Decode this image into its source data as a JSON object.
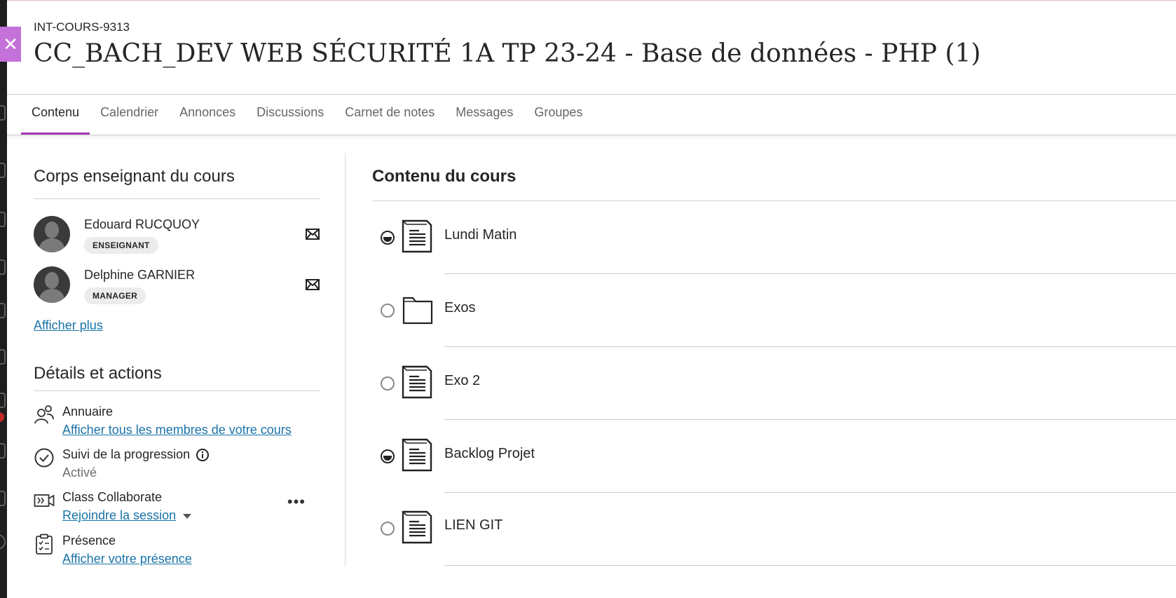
{
  "course": {
    "id": "INT-COURS-9313",
    "title": "CC_BACH_DEV WEB SÉCURITÉ 1A TP 23-24 - Base de données - PHP (1)"
  },
  "tabs": [
    {
      "label": "Contenu",
      "active": true
    },
    {
      "label": "Calendrier"
    },
    {
      "label": "Annonces"
    },
    {
      "label": "Discussions"
    },
    {
      "label": "Carnet de notes"
    },
    {
      "label": "Messages"
    },
    {
      "label": "Groupes"
    }
  ],
  "instructors": {
    "heading": "Corps enseignant du cours",
    "items": [
      {
        "name": "Edouard RUCQUOY",
        "role": "ENSEIGNANT"
      },
      {
        "name": "Delphine GARNIER",
        "role": "MANAGER"
      }
    ],
    "show_more": "Afficher plus"
  },
  "details": {
    "heading": "Détails et actions",
    "roster": {
      "title": "Annuaire",
      "link": "Afficher tous les membres de votre cours",
      "icon": "people-icon"
    },
    "progress": {
      "title": "Suivi de la progression",
      "status": "Activé",
      "icon": "check-circle-icon"
    },
    "collaborate": {
      "title": "Class Collaborate",
      "link": "Rejoindre la session",
      "more": "•••",
      "icon": "video-icon"
    },
    "attendance": {
      "title": "Présence",
      "link": "Afficher votre présence",
      "icon": "clipboard-icon"
    }
  },
  "content": {
    "heading": "Contenu du cours",
    "items": [
      {
        "title": "Lundi Matin",
        "type": "document",
        "progress": "in-progress"
      },
      {
        "title": "Exos",
        "type": "folder",
        "progress": "not-started"
      },
      {
        "title": "Exo 2",
        "type": "document",
        "progress": "not-started"
      },
      {
        "title": "Backlog Projet",
        "type": "document",
        "progress": "in-progress"
      },
      {
        "title": "LIEN GIT",
        "type": "document",
        "progress": "not-started"
      }
    ]
  },
  "colors": {
    "accent": "#a23ab4",
    "close_button": "#c471d9",
    "link": "#1a73a8"
  }
}
